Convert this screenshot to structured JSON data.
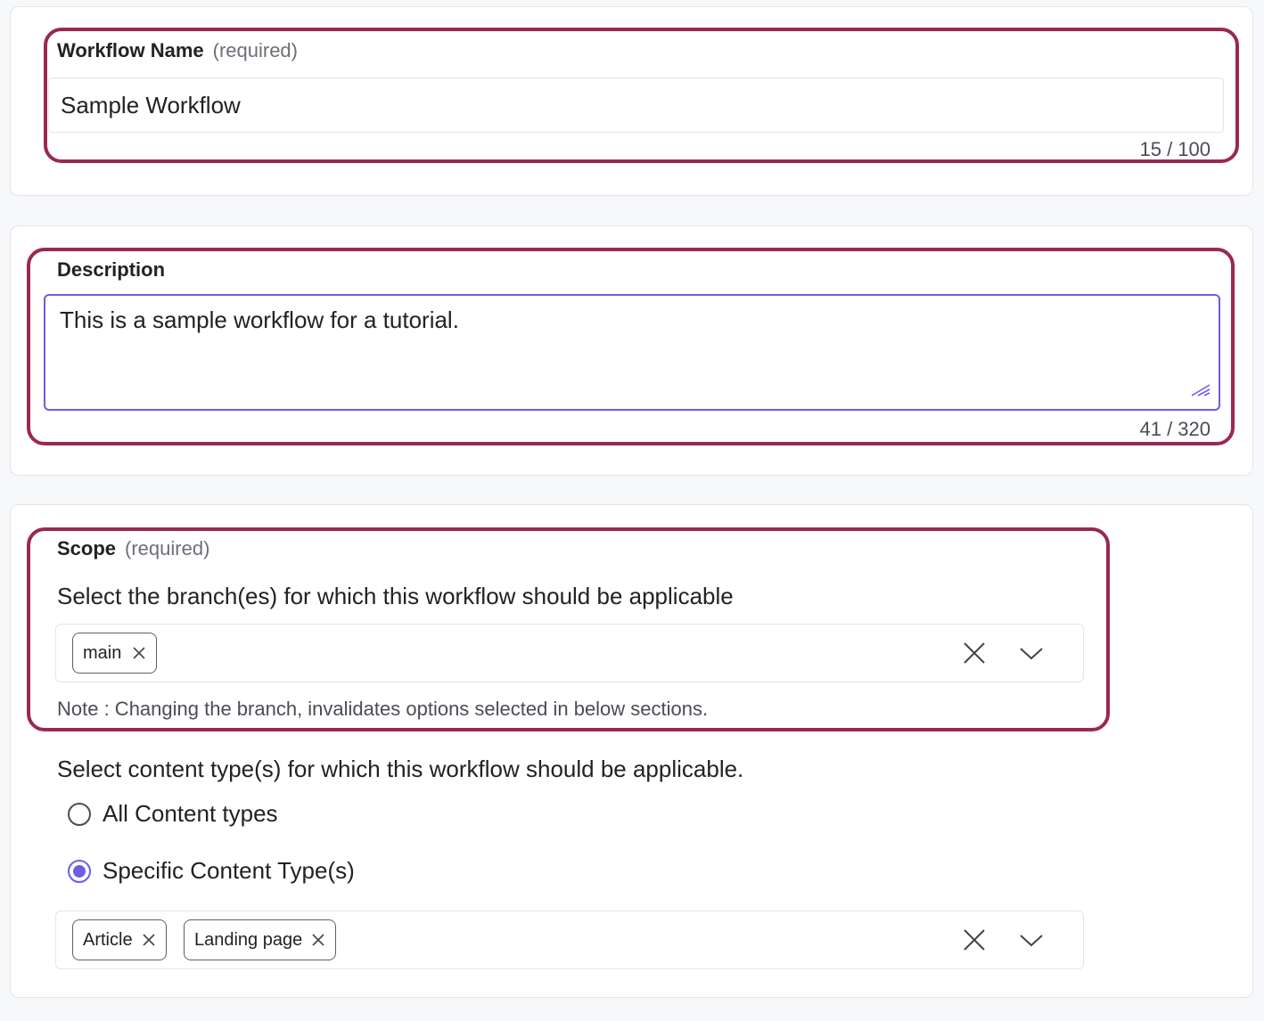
{
  "workflow_name": {
    "label": "Workflow Name",
    "required_tag": "(required)",
    "value": "Sample Workflow",
    "counter": "15 / 100"
  },
  "description": {
    "label": "Description",
    "value": "This is a sample workflow for a tutorial.",
    "counter": "41 / 320"
  },
  "scope": {
    "label": "Scope",
    "required_tag": "(required)",
    "branch_prompt": "Select the branch(es) for which this workflow should be applicable",
    "branch_chips": [
      "main"
    ],
    "note": "Note : Changing the branch, invalidates options selected in below sections.",
    "content_type_prompt": "Select content type(s) for which this workflow should be applicable.",
    "radio_options": [
      {
        "label": "All Content types",
        "checked": false
      },
      {
        "label": "Specific Content Type(s)",
        "checked": true
      }
    ],
    "content_type_chips": [
      "Article",
      "Landing page"
    ]
  },
  "colors": {
    "highlight": "#9b2754",
    "accent": "#6c5ce7",
    "page_background": "#f7f8fa"
  },
  "icons": {
    "chip_remove": "close-icon",
    "clear_all": "close-icon",
    "dropdown": "chevron-down-icon",
    "resize": "resize-handle-icon"
  }
}
